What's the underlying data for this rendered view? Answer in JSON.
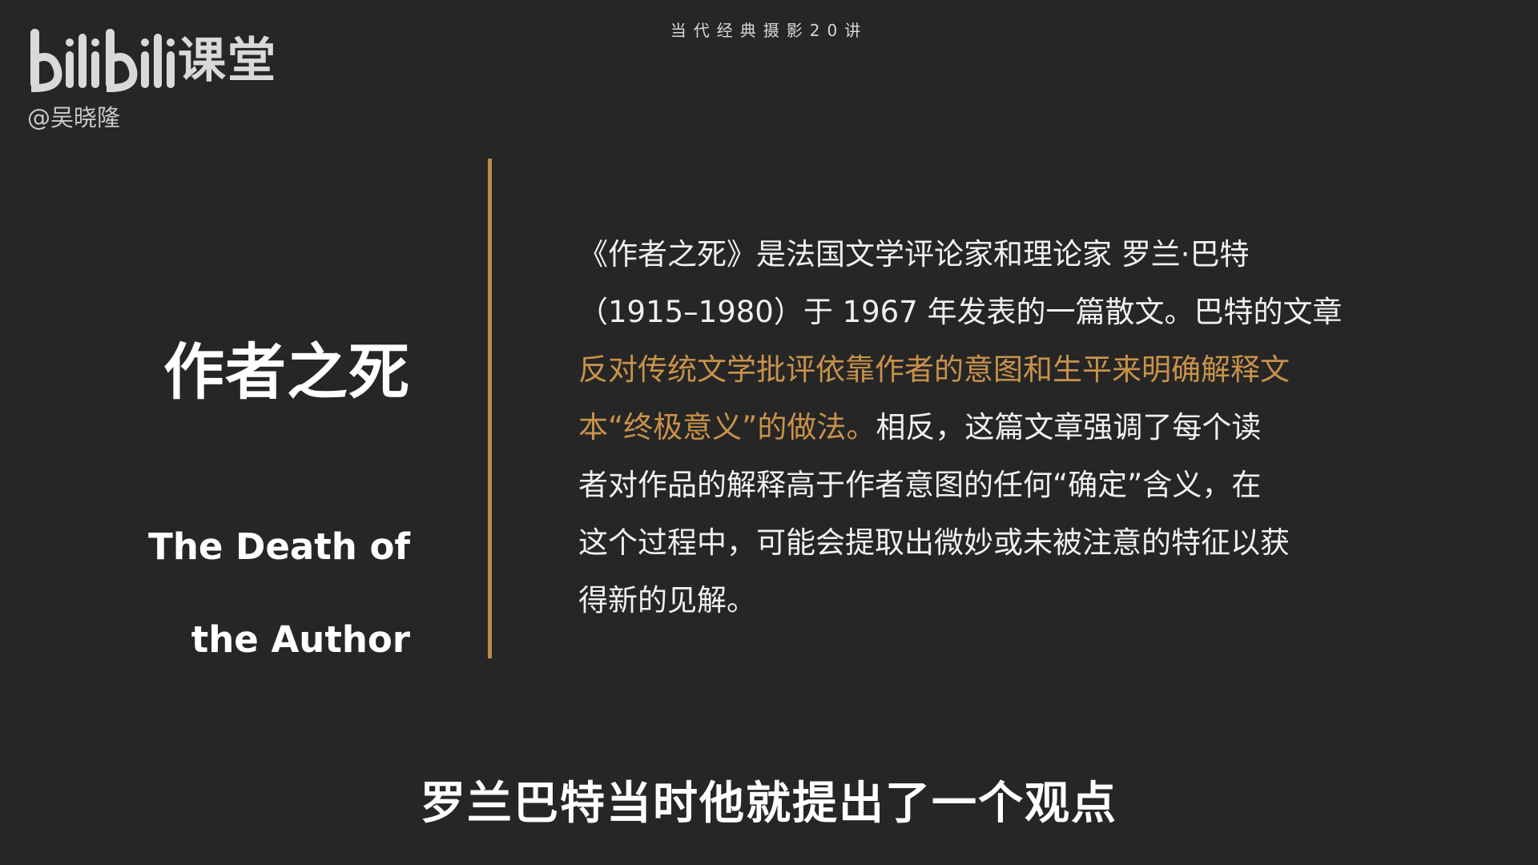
{
  "header": {
    "series_title": "当代经典摄影20讲"
  },
  "branding": {
    "logo_text": "bilibili",
    "logo_suffix": "课堂",
    "uploader": "@吴晓隆"
  },
  "slide": {
    "title_zh": "作者之死",
    "title_en_line1": "The Death of",
    "title_en_line2": "the Author",
    "description": {
      "line1": "《作者之死》是法国文学评论家和理论家 罗兰·巴特",
      "line2": "（1915–1980）于 1967 年发表的一篇散文。巴特的文章",
      "line3_highlight": "反对传统文学批评依靠作者的意图和生平来明确解释文",
      "line4_highlight": "本“终极意义”的做法。",
      "line4_rest": "相反，这篇文章强调了每个读",
      "line5": "者对作品的解释高于作者意图的任何“确定”含义，在",
      "line6": "这个过程中，可能会提取出微妙或未被注意的特征以获",
      "line7": "得新的见解。"
    }
  },
  "caption": {
    "subtitle": "罗兰巴特当时他就提出了一个观点"
  },
  "colors": {
    "background": "#262626",
    "accent": "#c9924a",
    "divider": "#b88c4c"
  }
}
